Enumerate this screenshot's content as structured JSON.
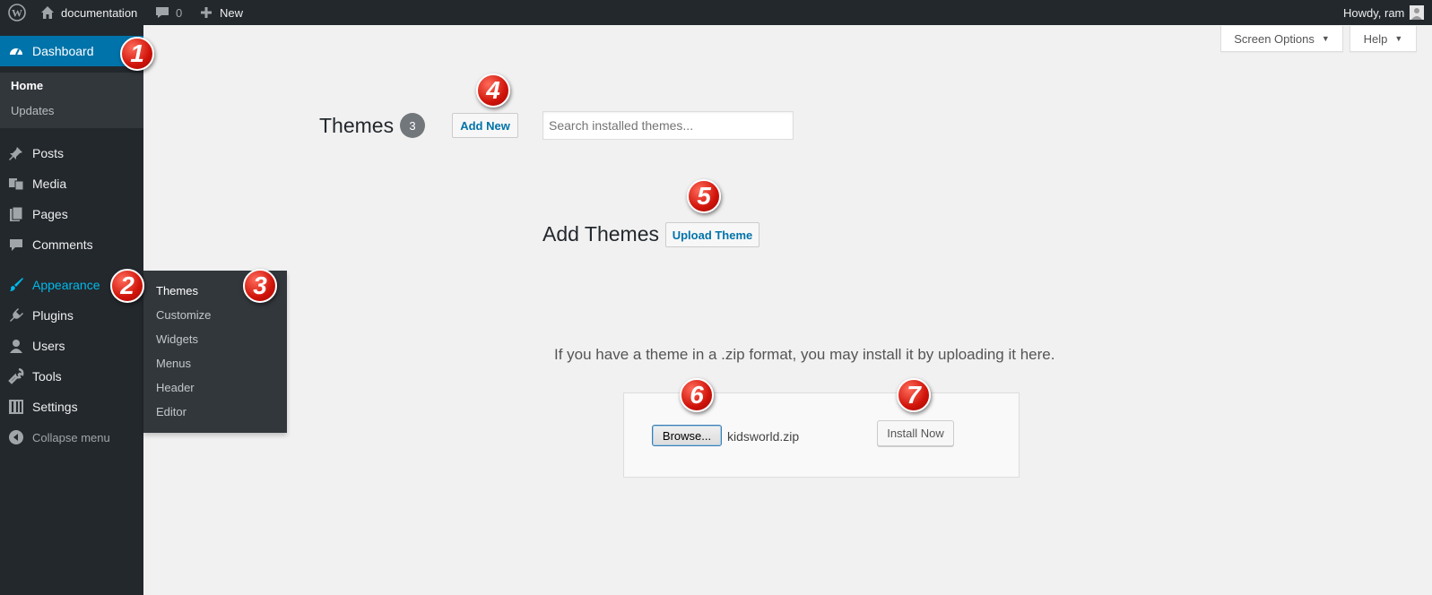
{
  "adminbar": {
    "site_name": "documentation",
    "comments_count": "0",
    "new_label": "New",
    "greeting": "Howdy, ram"
  },
  "sidebar": {
    "dashboard_label": "Dashboard",
    "dashboard_sub": [
      "Home",
      "Updates"
    ],
    "items": [
      {
        "label": "Posts",
        "icon": "pin-icon"
      },
      {
        "label": "Media",
        "icon": "media-icon"
      },
      {
        "label": "Pages",
        "icon": "pages-icon"
      },
      {
        "label": "Comments",
        "icon": "comment-icon"
      },
      {
        "label": "Appearance",
        "icon": "brush-icon"
      },
      {
        "label": "Plugins",
        "icon": "plugin-icon"
      },
      {
        "label": "Users",
        "icon": "user-icon"
      },
      {
        "label": "Tools",
        "icon": "wrench-icon"
      },
      {
        "label": "Settings",
        "icon": "settings-icon"
      }
    ],
    "collapse_label": "Collapse menu",
    "accent": "#0073aa"
  },
  "flyout": {
    "items": [
      "Themes",
      "Customize",
      "Widgets",
      "Menus",
      "Header",
      "Editor"
    ]
  },
  "screen_options_label": "Screen Options",
  "help_label": "Help",
  "themes": {
    "title": "Themes",
    "count": "3",
    "add_new_label": "Add New",
    "search_placeholder": "Search installed themes..."
  },
  "add_themes": {
    "title": "Add Themes",
    "upload_label": "Upload Theme",
    "description": "If you have a theme in a .zip format, you may install it by uploading it here.",
    "browse_label": "Browse...",
    "file_name": "kidsworld.zip",
    "install_label": "Install Now"
  },
  "callouts": [
    "1",
    "2",
    "3",
    "4",
    "5",
    "6",
    "7"
  ]
}
